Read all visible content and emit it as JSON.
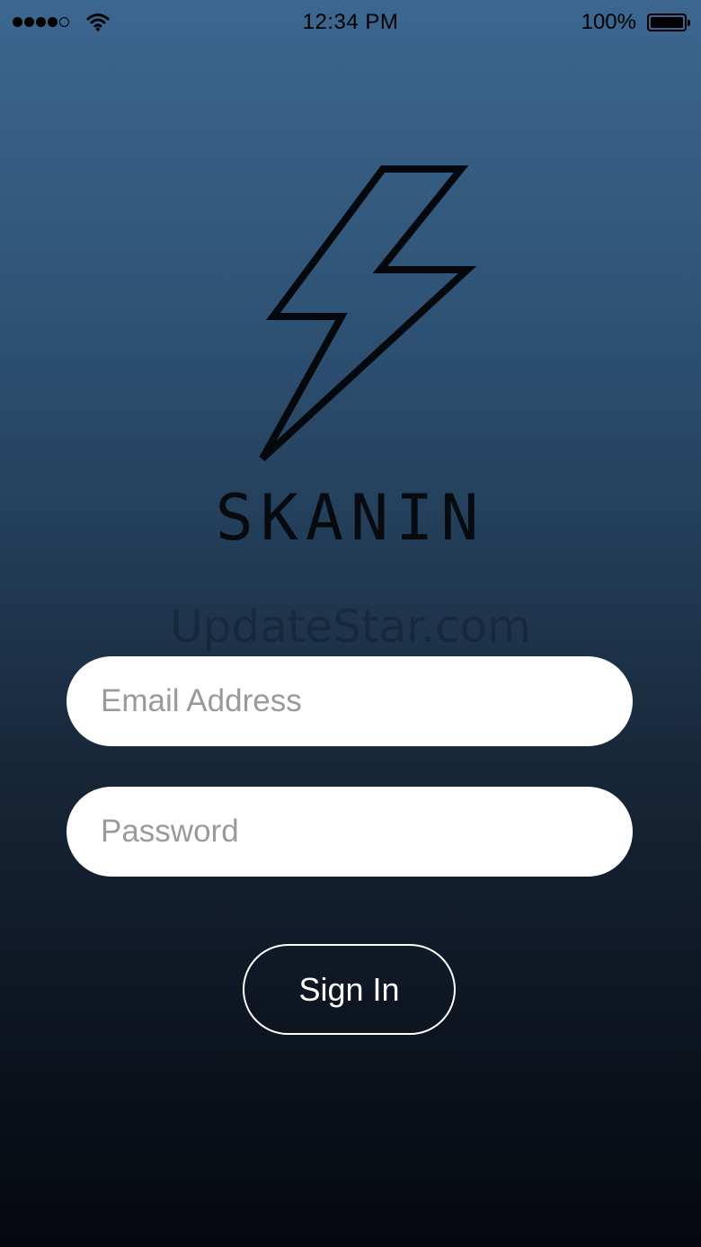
{
  "status_bar": {
    "time": "12:34 PM",
    "battery_percent": "100%",
    "signal_bars_filled": 4,
    "signal_bars_total": 5
  },
  "brand": {
    "name": "SKANIN",
    "logo_icon": "lightning-bolt-icon"
  },
  "watermark": "UpdateStar.com",
  "form": {
    "email_placeholder": "Email Address",
    "email_value": "",
    "password_placeholder": "Password",
    "password_value": "",
    "sign_in_label": "Sign In"
  },
  "colors": {
    "background_top": "#3c6790",
    "background_bottom": "#05080d",
    "field_background": "#ffffff",
    "button_border": "#ffffff"
  }
}
